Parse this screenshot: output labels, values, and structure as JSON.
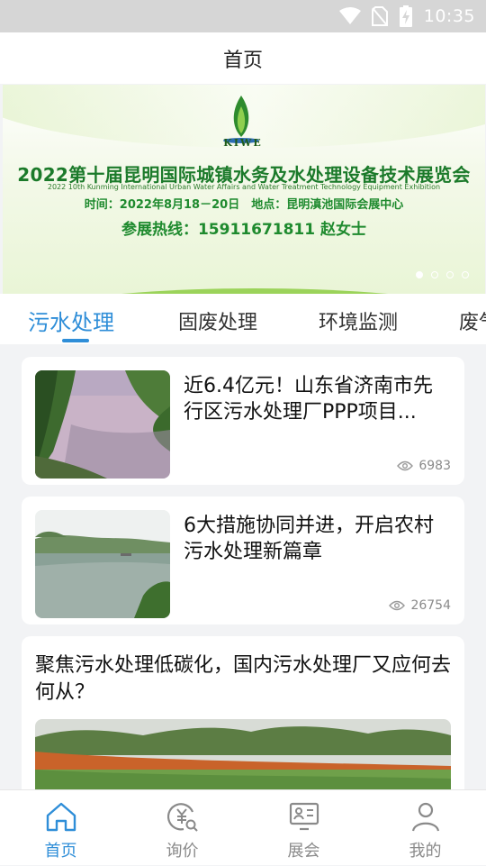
{
  "status_bar": {
    "time": "10:35"
  },
  "header": {
    "title": "首页"
  },
  "banner": {
    "logo_text": "KIWE",
    "title": "2022第十届昆明国际城镇水务及水处理设备技术展览会",
    "subtitle": "2022 10th Kunming International Urban Water Affairs and Water Treatment Technology Equipment Exhibition",
    "info": "时间：2022年8月18－20日　地点：昆明滇池国际会展中心",
    "hotline": "参展热线：15911671811 赵女士",
    "slide_count": 4,
    "active_slide": 1
  },
  "category_tabs": [
    {
      "label": "污水处理",
      "active": true
    },
    {
      "label": "固废处理",
      "active": false
    },
    {
      "label": "环境监测",
      "active": false
    },
    {
      "label": "废气",
      "active": false
    }
  ],
  "articles": [
    {
      "title": "近6.4亿元！山东省济南市先行区污水处理厂PPP项目...",
      "views": "6983"
    },
    {
      "title": "6大措施协同并进，开启农村污水处理新篇章",
      "views": "26754"
    },
    {
      "title": "聚焦污水处理低碳化，国内污水处理厂又应何去何从？"
    }
  ],
  "bottom_nav": [
    {
      "label": "首页",
      "icon": "home-icon",
      "active": true
    },
    {
      "label": "询价",
      "icon": "inquiry-icon",
      "active": false
    },
    {
      "label": "展会",
      "icon": "exhibition-icon",
      "active": false
    },
    {
      "label": "我的",
      "icon": "profile-icon",
      "active": false
    }
  ],
  "colors": {
    "accent": "#2f8ed8",
    "inactive": "#8a8a8a",
    "background": "#f2f3f5"
  }
}
